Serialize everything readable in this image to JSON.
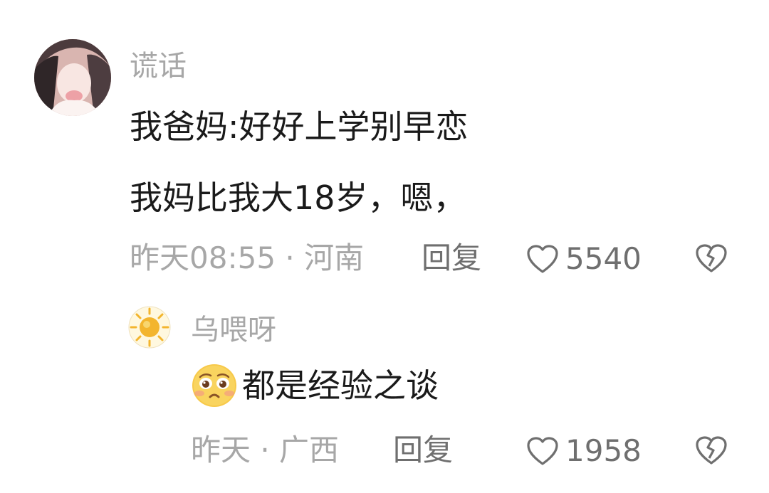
{
  "comment": {
    "username": "谎话",
    "lines": [
      "我爸妈:好好上学别早恋",
      "我妈比我大18岁，嗯，"
    ],
    "meta": "昨天08:55 · 河南",
    "reply_label": "回复",
    "likes": "5540",
    "icons": {
      "avatar": "user-avatar",
      "like": "heart-outline-icon",
      "dislike": "broken-heart-icon"
    }
  },
  "reply": {
    "username": "乌喂呀",
    "text": "都是经验之谈",
    "meta": "昨天 · 广西",
    "reply_label": "回复",
    "likes": "1958",
    "icons": {
      "avatar": "sun-avatar",
      "emoji": "pleading-face-emoji",
      "like": "heart-outline-icon",
      "dislike": "broken-heart-icon"
    }
  },
  "colors": {
    "text": "#1a1a1a",
    "meta": "#a7a7a7",
    "action": "#6f6f6f",
    "background": "#ffffff",
    "sun": "#f3b52e"
  }
}
